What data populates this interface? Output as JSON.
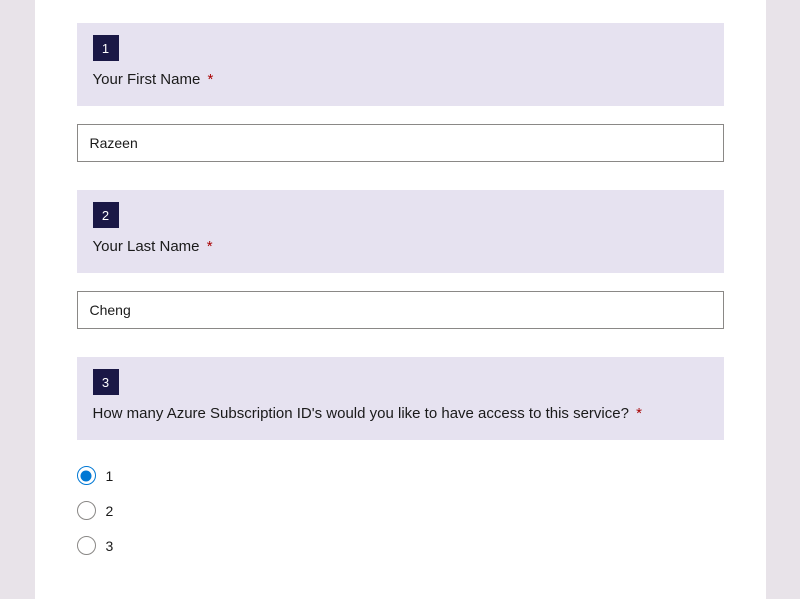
{
  "questions": {
    "q1": {
      "number": "1",
      "label": "Your First Name",
      "required": "*",
      "value": "Razeen"
    },
    "q2": {
      "number": "2",
      "label": "Your Last Name",
      "required": "*",
      "value": "Cheng"
    },
    "q3": {
      "number": "3",
      "label": "How many Azure Subscription ID's would you like to have access to this service?",
      "required": "*",
      "options": {
        "opt1": "1",
        "opt2": "2",
        "opt3": "3"
      },
      "selected": "1"
    }
  }
}
